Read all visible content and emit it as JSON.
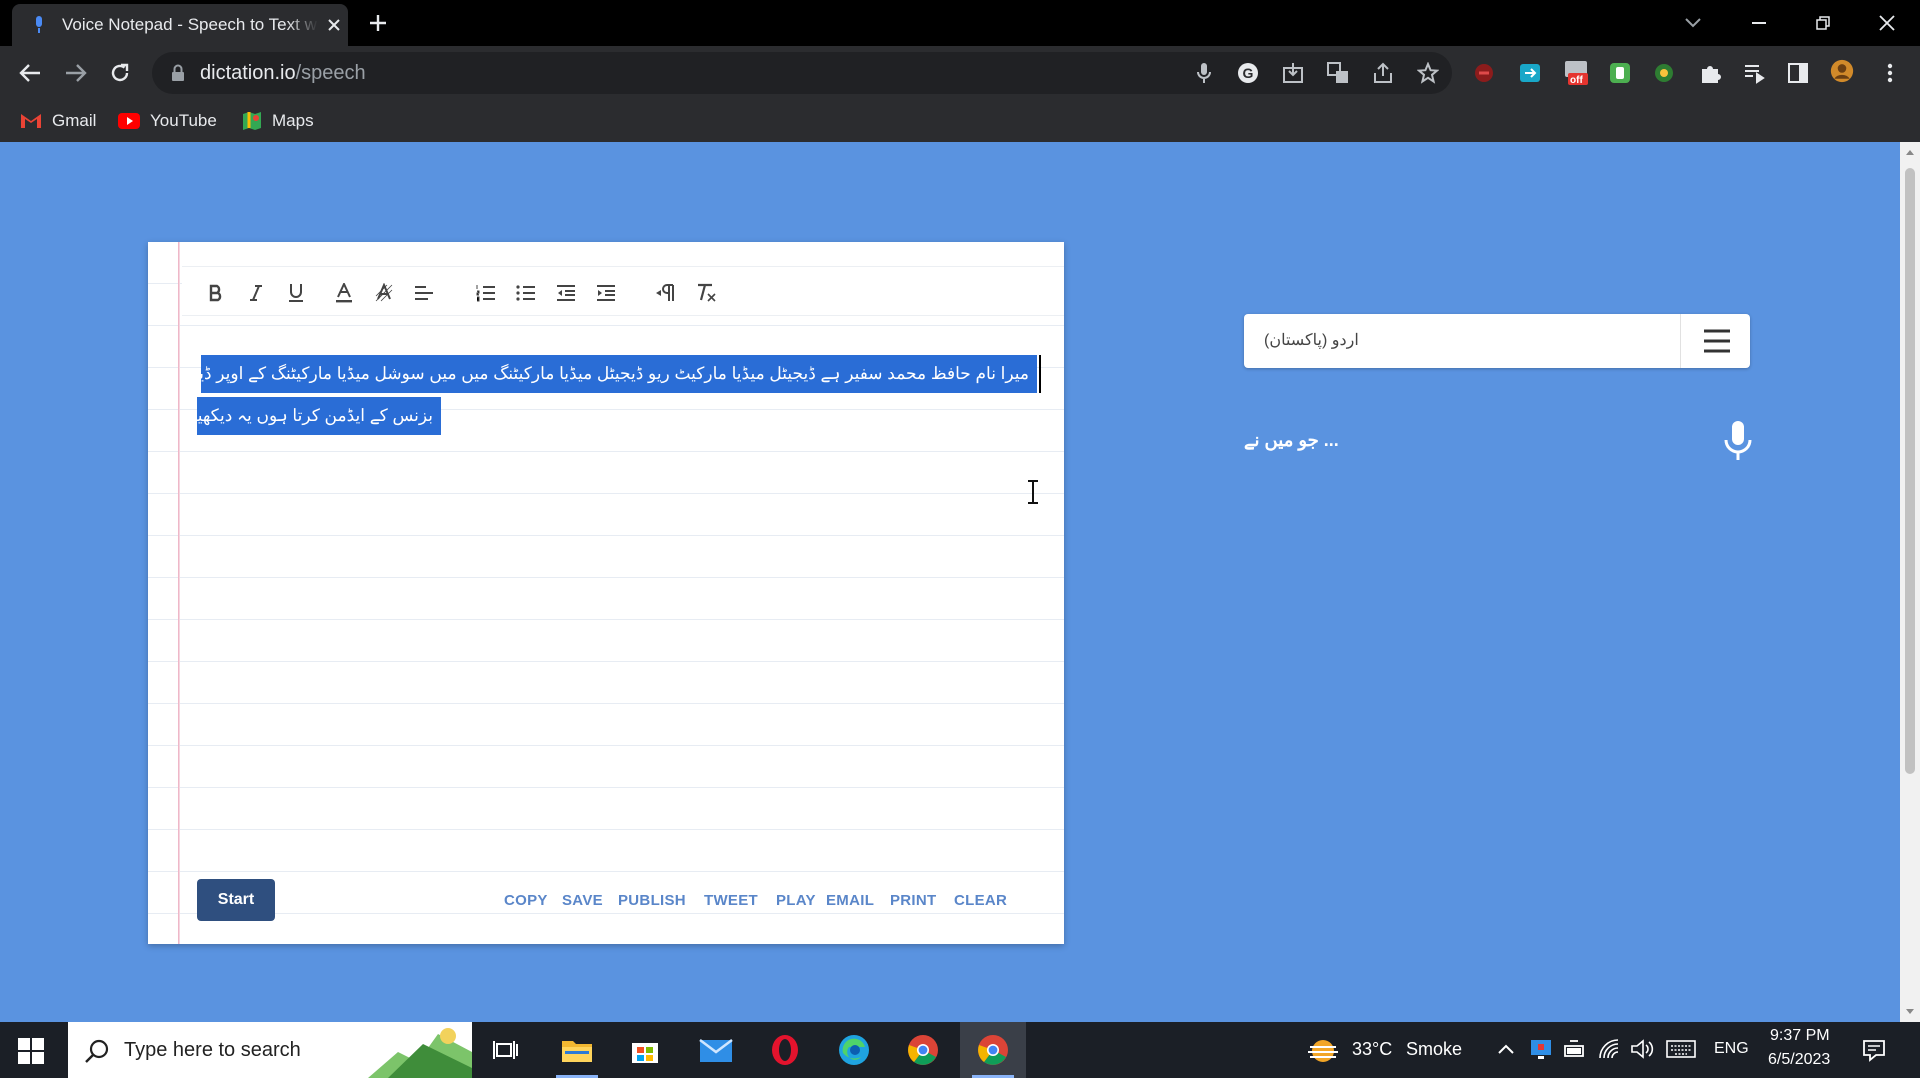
{
  "browser": {
    "tab_title": "Voice Notepad - Speech to Text with",
    "url_domain": "dictation.io",
    "url_path": "/speech",
    "bookmarks": [
      {
        "label": "Gmail",
        "icon": "gmail-icon"
      },
      {
        "label": "YouTube",
        "icon": "youtube-icon"
      },
      {
        "label": "Maps",
        "icon": "maps-icon"
      }
    ],
    "extension_badge": "off"
  },
  "editor": {
    "toolbar": [
      "bold",
      "italic",
      "underline",
      "font-color",
      "highlight",
      "align",
      "ordered-list",
      "bullet-list",
      "outdent",
      "indent",
      "rtl-paragraph",
      "clear-format"
    ],
    "text_line1": "میرا نام حافظ محمد سفیر ہے ڈیجیٹل میڈیا مارکیٹ ریو ڈیجیٹل میڈیا مارکیٹنگ میں میں سوشل میڈیا مارکیٹنگ کے اوپر ڈیفرنٹ",
    "text_line2": "بزنس کے ایڈمن کرتا ہوں یہ دیکھیں",
    "start_label": "Start",
    "actions": [
      "COPY",
      "SAVE",
      "PUBLISH",
      "TWEET",
      "PLAY",
      "EMAIL",
      "PRINT",
      "CLEAR"
    ]
  },
  "sidebar": {
    "language": "اردو (پاکستان)",
    "interim_text": "... جو میں نے"
  },
  "taskbar": {
    "search_placeholder": "Type here to search",
    "weather_temp": "33°C",
    "weather_desc": "Smoke",
    "lang": "ENG",
    "time": "9:37 PM",
    "date": "6/5/2023"
  },
  "colors": {
    "page_bg": "#5a93e0",
    "selection": "#2a6dd6",
    "start_button": "#2f4f7f",
    "action_link": "#5a86c9"
  }
}
